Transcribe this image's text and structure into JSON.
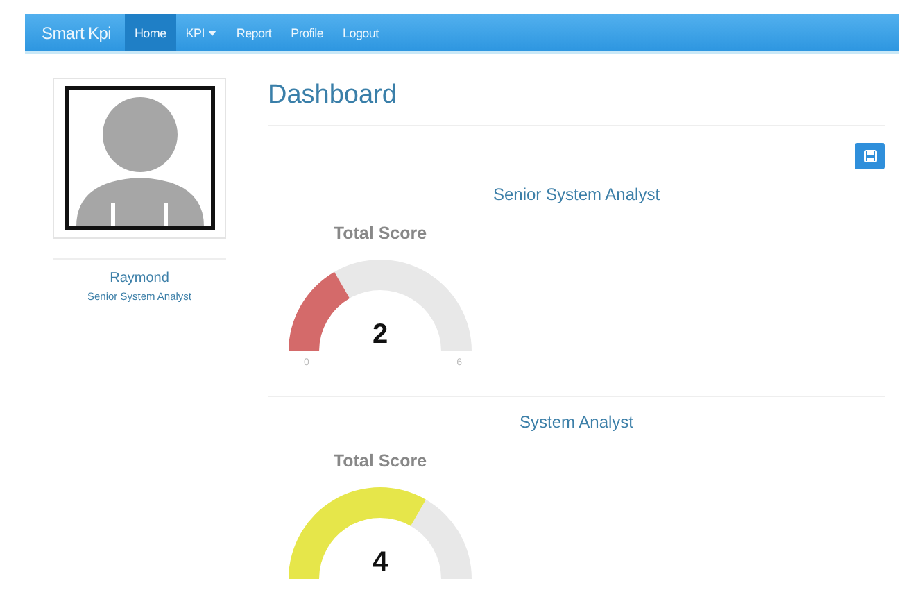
{
  "navbar": {
    "brand": "Smart Kpi",
    "items": [
      {
        "label": "Home",
        "selected": true,
        "kind": "link"
      },
      {
        "label": "KPI",
        "selected": false,
        "kind": "dropdown"
      },
      {
        "label": "Report",
        "selected": false,
        "kind": "link"
      },
      {
        "label": "Profile",
        "selected": false,
        "kind": "link"
      },
      {
        "label": "Logout",
        "selected": false,
        "kind": "link"
      }
    ]
  },
  "profile": {
    "name": "Raymond",
    "role": "Senior System Analyst"
  },
  "dashboard": {
    "title": "Dashboard",
    "sections": [
      {
        "heading": "Senior System Analyst",
        "gauge": {
          "title": "Total Score",
          "value": "2",
          "color": "#d46a6a",
          "min": "0",
          "max": "6"
        }
      },
      {
        "heading": "System Analyst",
        "gauge": {
          "title": "Total Score",
          "value": "4",
          "color": "#e6e64a"
        }
      }
    ]
  }
}
